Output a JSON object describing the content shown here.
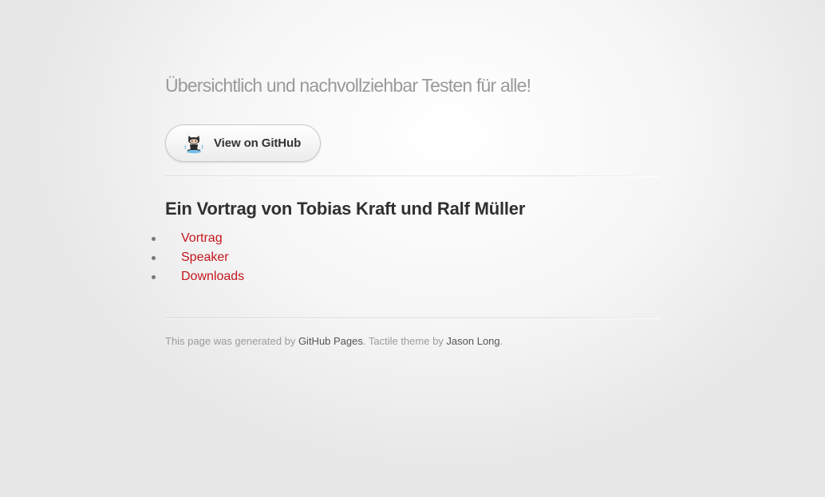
{
  "tagline": "Übersichtlich und nachvollziehbar Testen für alle!",
  "github_button": {
    "label": "View on GitHub",
    "icon": "octocat-icon"
  },
  "heading": "Ein Vortrag von Tobias Kraft und Ralf Müller",
  "nav": {
    "items": [
      {
        "label": "Vortrag"
      },
      {
        "label": "Speaker"
      },
      {
        "label": "Downloads"
      }
    ]
  },
  "footer": {
    "prefix": "This page was generated by ",
    "github_pages_link": "GitHub Pages",
    "middle": ". Tactile theme by ",
    "author_link": "Jason Long",
    "suffix": "."
  },
  "colors": {
    "link": "#c4161c",
    "tagline": "#9a9a9a",
    "heading": "#303030"
  }
}
